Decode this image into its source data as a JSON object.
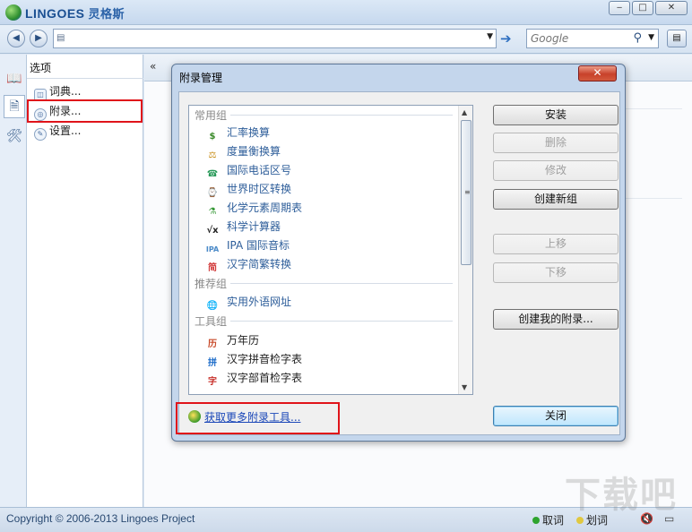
{
  "app": {
    "brand": "LINGOES",
    "brand_cn": "灵格斯"
  },
  "window_controls": {
    "minimize": "‒",
    "maximize": "□",
    "close": "✕"
  },
  "toolbar": {
    "back": "◀",
    "forward": "▶",
    "address_value": "",
    "go_icon": "➔",
    "search_placeholder": "Google",
    "search_icon": "⚲",
    "menu_icon": "▤"
  },
  "iconbar": [
    "dictionary-icon",
    "appendix-icon",
    "settings-icon"
  ],
  "options": {
    "header": "选项",
    "items": [
      {
        "label": "词典...",
        "icon": "dictionary-icon"
      },
      {
        "label": "附录...",
        "icon": "appendix-icon"
      },
      {
        "label": "设置...",
        "icon": "wrench-icon"
      }
    ]
  },
  "main": {
    "collapse_glyph": "«"
  },
  "dialog": {
    "title": "附录管理",
    "close_label": "✕",
    "groups": [
      {
        "name": "常用组",
        "items": [
          {
            "label": "汇率换算",
            "icon": "$",
            "color": "#3a8a2a"
          },
          {
            "label": "度量衡换算",
            "icon": "⚖",
            "color": "#c78a10"
          },
          {
            "label": "国际电话区号",
            "icon": "☎",
            "color": "#2a9a5a"
          },
          {
            "label": "世界时区转换",
            "icon": "⌚",
            "color": "#2a6bc0"
          },
          {
            "label": "化学元素周期表",
            "icon": "⚗",
            "color": "#3a9a3a"
          },
          {
            "label": "科学计算器",
            "icon": "√x",
            "color": "#222222"
          },
          {
            "label": "IPA 国际音标",
            "icon": "IPA",
            "color": "#4a8ac8"
          },
          {
            "label": "汉字简繁转换",
            "icon": "简",
            "color": "#d23a3a"
          }
        ]
      },
      {
        "name": "推荐组",
        "items": [
          {
            "label": "实用外语网址",
            "icon": "🌐",
            "color": "#2a7ac0"
          }
        ]
      },
      {
        "name": "工具组",
        "items": [
          {
            "label": "万年历",
            "icon": "历",
            "color": "#c84a2a"
          },
          {
            "label": "汉字拼音检字表",
            "icon": "拼",
            "color": "#1a6ac8"
          },
          {
            "label": "汉字部首检字表",
            "icon": "字",
            "color": "#c8302a"
          }
        ]
      }
    ],
    "buttons": {
      "install": "安装",
      "delete": "删除",
      "modify": "修改",
      "create_group": "创建新组",
      "move_up": "上移",
      "move_down": "下移",
      "create_mine": "创建我的附录...",
      "close": "关闭"
    },
    "more_link": "获取更多附录工具..."
  },
  "statusbar": {
    "copyright": "Copyright © 2006-2013 Lingoes Project",
    "items": [
      {
        "label": "取词",
        "color": "#2ea42e"
      },
      {
        "label": "划词",
        "color": "#e0c840"
      }
    ]
  },
  "watermark": "下载吧"
}
